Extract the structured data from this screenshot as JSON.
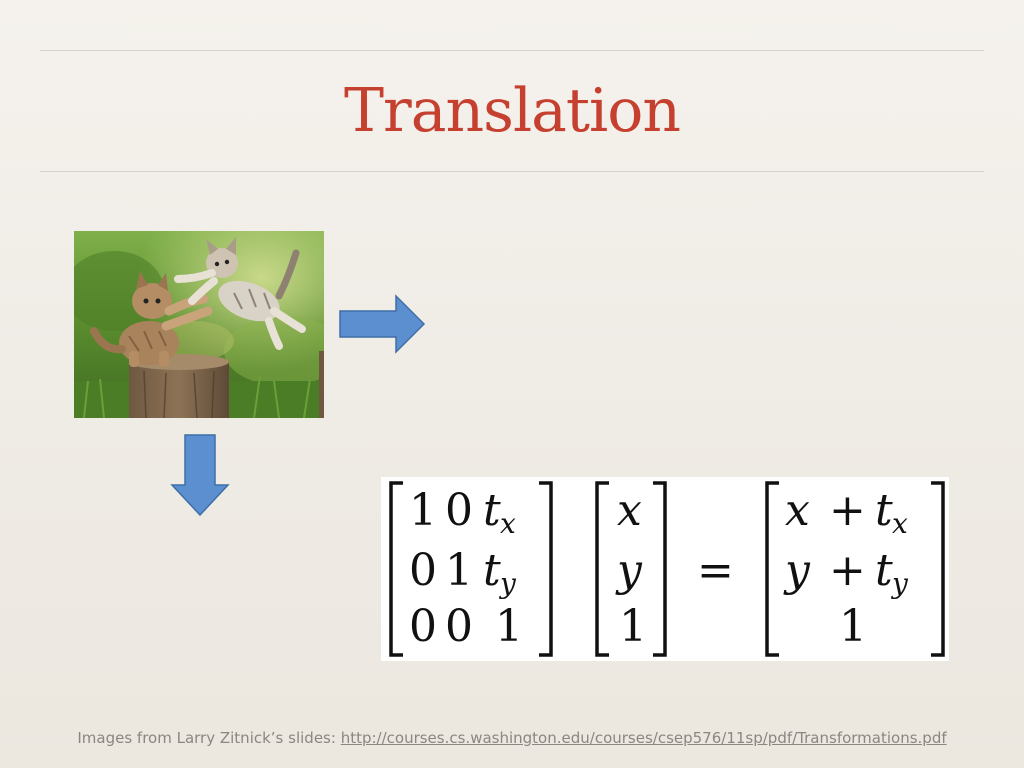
{
  "slide": {
    "title": "Translation",
    "accent_color": "#c6402f",
    "arrow_color": "#5b8fcf"
  },
  "image": {
    "subject": "two kittens playing on a tree stump",
    "icon": "photo-image"
  },
  "equation": {
    "matrix_rows": [
      [
        "1",
        "0",
        "t_x"
      ],
      [
        "0",
        "1",
        "t_y"
      ],
      [
        "0",
        "0",
        "1"
      ]
    ],
    "vector": [
      "x",
      "y",
      "1"
    ],
    "equals": "=",
    "result": [
      "x + t_x",
      "y + t_y",
      "1"
    ],
    "symbols": {
      "one": "1",
      "zero": "0",
      "t": "t",
      "x": "x",
      "y": "y",
      "plus": "+"
    }
  },
  "footer": {
    "prefix": "Images from Larry Zitnick’s slides: ",
    "link": "http://courses.cs.washington.edu/courses/csep576/11sp/pdf/Transformations.pdf"
  }
}
